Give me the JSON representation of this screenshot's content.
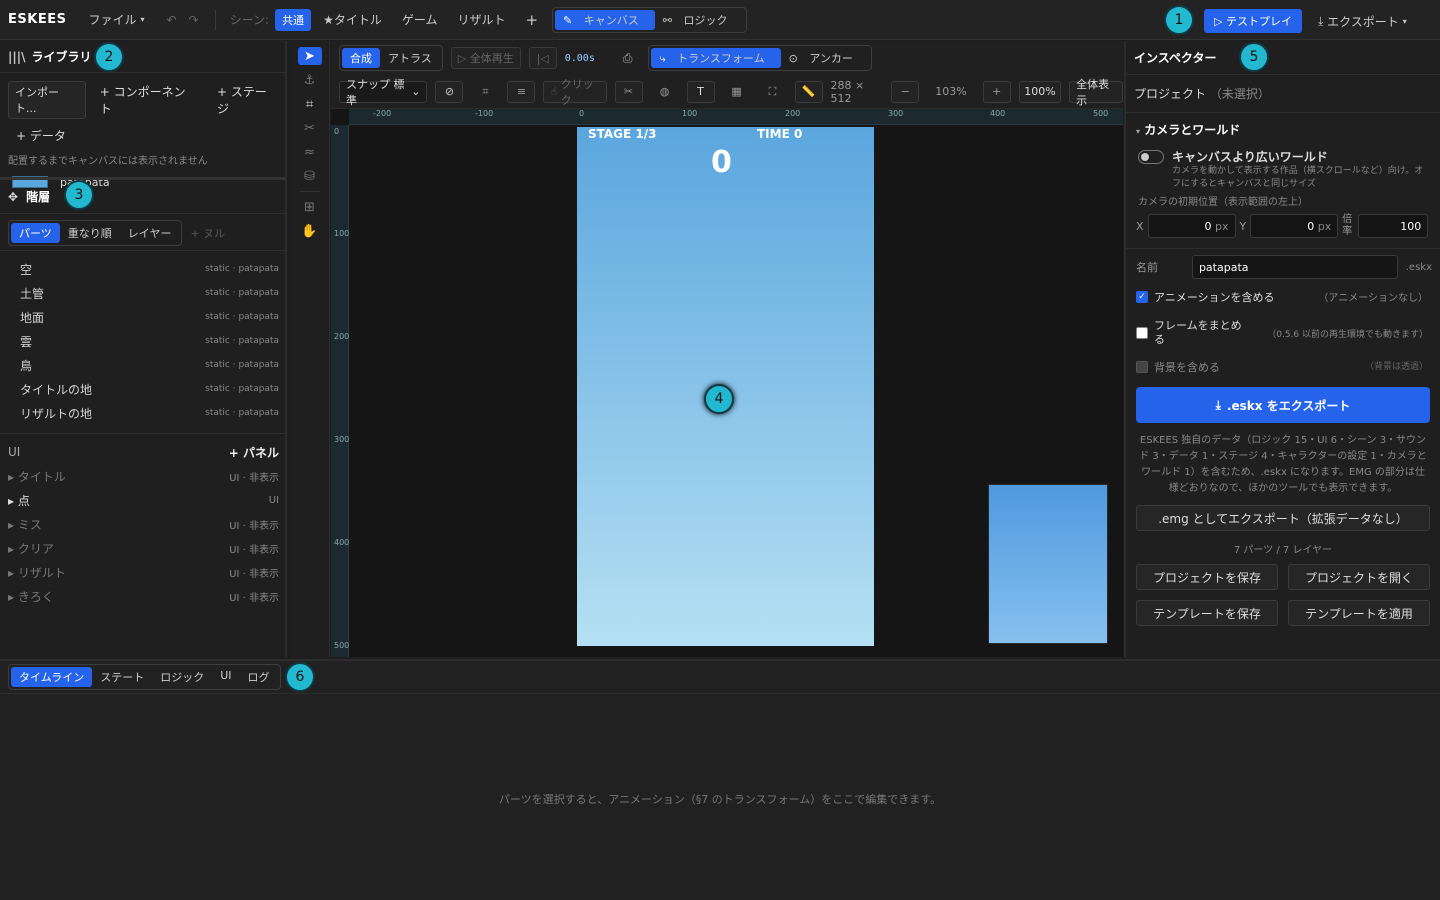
{
  "topbar": {
    "brand": "ESKEES",
    "file": "ファイル",
    "scene_label": "シーン:",
    "scenes": [
      "共通",
      "★タイトル",
      "ゲーム",
      "リザルト"
    ],
    "add": "+",
    "view_tabs": [
      "キャンバス",
      "ロジック"
    ],
    "testplay": "テストプレイ",
    "export": "エクスポート"
  },
  "badges": [
    "1",
    "2",
    "3",
    "4",
    "5",
    "6"
  ],
  "library": {
    "title": "ライブラリ",
    "buttons": [
      "インポート...",
      "+ コンポーネント",
      "+ ステージ",
      "+ データ"
    ],
    "note": "配置するまでキャンバスには表示されません",
    "asset": "patapata"
  },
  "hierarchy": {
    "title": "階層",
    "tabs": [
      "パーツ",
      "重なり順",
      "レイヤー"
    ],
    "null_btn": "+ ヌル",
    "parts": [
      {
        "name": "空",
        "meta": "static · patapata"
      },
      {
        "name": "土管",
        "meta": "static · patapata"
      },
      {
        "name": "地面",
        "meta": "static · patapata"
      },
      {
        "name": "雲",
        "meta": "static · patapata"
      },
      {
        "name": "鳥",
        "meta": "static · patapata"
      },
      {
        "name": "タイトルの地",
        "meta": "static · patapata"
      },
      {
        "name": "リザルトの地",
        "meta": "static · patapata"
      }
    ],
    "ui_label": "UI",
    "add_panel": "+ パネル",
    "ui_items": [
      {
        "name": "タイトル",
        "meta": "UI · 非表示"
      },
      {
        "name": "点",
        "meta": "UI"
      },
      {
        "name": "ミス",
        "meta": "UI · 非表示"
      },
      {
        "name": "クリア",
        "meta": "UI · 非表示"
      },
      {
        "name": "リザルト",
        "meta": "UI · 非表示"
      },
      {
        "name": "きろく",
        "meta": "UI · 非表示"
      }
    ]
  },
  "canvas": {
    "mode_tabs": [
      "合成",
      "アトラス"
    ],
    "play_all": "全体再生",
    "time": "0.00s",
    "transform": "トランスフォーム",
    "anchor": "アンカー",
    "snap": "スナップ 標準",
    "click": "クリック",
    "size": "288 × 512",
    "zoom": "103%",
    "zoom_100": "100%",
    "fit": "全体表示",
    "ruler_h": [
      "-200",
      "-100",
      "0",
      "100",
      "200",
      "300",
      "400",
      "500"
    ],
    "ruler_v": [
      "0",
      "100",
      "200",
      "300",
      "400",
      "500"
    ],
    "stage_text": {
      "stage": "STAGE 1/3",
      "time": "TIME 0",
      "score": "0"
    }
  },
  "inspector": {
    "title": "インスペクター",
    "project": "プロジェクト",
    "unselected": "（未選択）",
    "section": "カメラとワールド",
    "wide_world": "キャンバスより広いワールド",
    "wide_desc": "カメラを動かして表示する作品（横スクロールなど）向け。オフにするとキャンバスと同じサイズ",
    "cam_init": "カメラの初期位置（表示範囲の左上）",
    "x_label": "X",
    "x_val": "0",
    "y_label": "Y",
    "y_val": "0",
    "px": "px",
    "scale_label": "倍率",
    "scale_val": "100",
    "name_label": "名前",
    "name_val": "patapata",
    "ext": ".eskx",
    "anim": "アニメーションを含める",
    "anim_note": "（アニメーションなし）",
    "frames": "フレームをまとめる",
    "frames_note": "（0.5.6 以前の再生環境でも動きます）",
    "bg": "背景を含める",
    "bg_note": "（背景は透過）",
    "export_btn": ".eskx をエクスポート",
    "export_desc": "ESKEES 独自のデータ（ロジック 15・UI 6・シーン 3・サウンド 3・データ 1・ステージ 4・キャラクターの設定 1・カメラとワールド 1）を含むため、.eskx になります。EMG の部分は仕様どおりなので、ほかのツールでも表示できます。",
    "emg_btn": ".emg としてエクスポート（拡張データなし）",
    "counts": "7 パーツ / 7 レイヤー",
    "btns": [
      "プロジェクトを保存",
      "プロジェクトを開く",
      "テンプレートを保存",
      "テンプレートを適用"
    ]
  },
  "bottom": {
    "tabs": [
      "タイムライン",
      "ステート",
      "ロジック",
      "UI",
      "ログ"
    ],
    "hint": "パーツを選択すると、アニメーション（§7 のトランスフォーム）をここで編集できます。"
  }
}
